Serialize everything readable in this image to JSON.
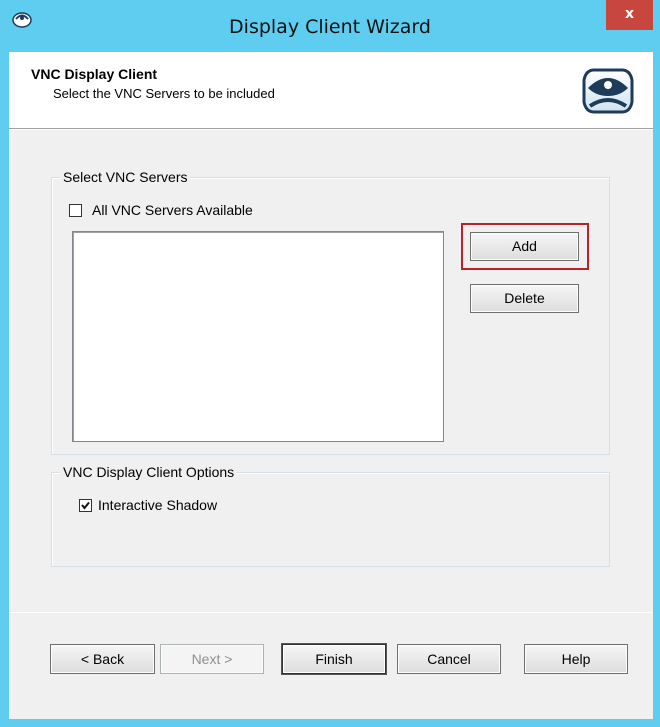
{
  "window": {
    "title": "Display Client Wizard",
    "close_label": "x"
  },
  "header": {
    "title": "VNC Display Client",
    "subtitle": "Select the VNC Servers to be included",
    "logo_icon": "thinmanager-logo-icon"
  },
  "servers_group": {
    "label": "Select VNC Servers",
    "all_available": {
      "label": "All VNC Servers Available",
      "checked": false
    },
    "servers": [],
    "add_label": "Add",
    "delete_label": "Delete"
  },
  "options_group": {
    "label": "VNC Display Client Options",
    "interactive_shadow": {
      "label": "Interactive Shadow",
      "checked": true
    }
  },
  "footer": {
    "back_label": "< Back",
    "next_label": "Next >",
    "finish_label": "Finish",
    "cancel_label": "Cancel",
    "help_label": "Help"
  },
  "colors": {
    "titlebar": "#5ecdef",
    "close": "#c7463e",
    "highlight": "#b8232b"
  }
}
